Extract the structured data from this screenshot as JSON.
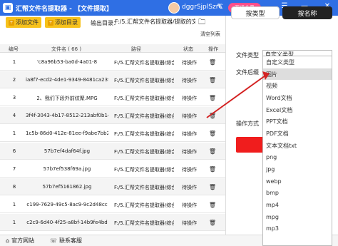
{
  "app": {
    "title": "汇帮文件名提取器 - 【文件提取】",
    "username": "dggrSjplSzrC",
    "vip_label": "开通会员"
  },
  "toolbar": {
    "add_file": "添加文件",
    "add_folder": "添加目录",
    "output_label": "输出目录：",
    "output_path": "F:/5.汇帮文件名提取器/提取的文件",
    "clear_list": "清空列表"
  },
  "table": {
    "headers": [
      "编号",
      "文件名 ( 66 )",
      "路径",
      "状态",
      "操作"
    ],
    "rows": [
      {
        "idx": "1",
        "name": "'c8a96b53-ba0d-4a01-8",
        "path": "F:/5.汇帮文件名提取器/综合文件/4cd",
        "status": "待操作"
      },
      {
        "idx": "2",
        "name": "ia8f7-ecd2-4de1-9349-8481ca23f20",
        "path": "F:/5.汇帮文件名提取器/综合文件/cf2",
        "status": "待操作"
      },
      {
        "idx": "3",
        "name": "2、我们下段外前纹聚.MPG",
        "path": "F:/5.汇帮文件名提取器/综合文件/2、",
        "status": "待操作"
      },
      {
        "idx": "4",
        "name": "3f4f-3043-4b17-8512-213abf0b143ff",
        "path": "F:/5.汇帮文件名提取器/综合文件/31cf",
        "status": "待操作"
      },
      {
        "idx": "1",
        "name": "1c5b-86d0-412e-81ee-f9abe7bb2b7",
        "path": "F:/5.汇帮文件名提取器/综合文件/dfc",
        "status": "待操作"
      },
      {
        "idx": "6",
        "name": "57b7ef4daf64f.jpg",
        "path": "F:/5.汇帮文件名提取器/综合文件/57b7",
        "status": "待操作"
      },
      {
        "idx": "7",
        "name": "57b7ef538f69a.jpg",
        "path": "F:/5.汇帮文件名提取器/综合文件/57b7",
        "status": "待操作"
      },
      {
        "idx": "8",
        "name": "57b7ef5161862.jpg",
        "path": "F:/5.汇帮文件名提取器/综合文件/57b7",
        "status": "待操作"
      },
      {
        "idx": "1",
        "name": "c199-7629-49c5-8ac9-9c2d48cc",
        "path": "F:/5.汇帮文件名提取器/综合文件/34c",
        "status": "待操作"
      },
      {
        "idx": "1",
        "name": "c2c9-6d40-4f25-a8bf-14b9fe4bd",
        "path": "F:/5.汇帮文件名提取器/综合文件/1b4",
        "status": "待操作"
      }
    ]
  },
  "bottom": {
    "website": "官方网站",
    "support": "联系客服"
  },
  "panel": {
    "tab_by_type": "按类型",
    "tab_by_name": "按名称",
    "file_type_label": "文件类型",
    "file_type_value": "自定义类型",
    "suffix_label": "文件后缀",
    "action_label": "操作方式",
    "dropdown_options": [
      "自定义类型",
      "图片",
      "视频",
      "Word文档",
      "Excel文档",
      "PPT文档",
      "PDF文档",
      "文本文档txt",
      "png",
      "jpg",
      "webp",
      "bmp",
      "mp4",
      "mpg",
      "mp3"
    ],
    "highlighted_option": "图片"
  },
  "colors": {
    "titlebar": "#2f6fe4",
    "toolbar_button": "#f7c21b",
    "vip": "#ff4f8b",
    "arrow": "#d42424",
    "action_button": "#f01d1d"
  }
}
